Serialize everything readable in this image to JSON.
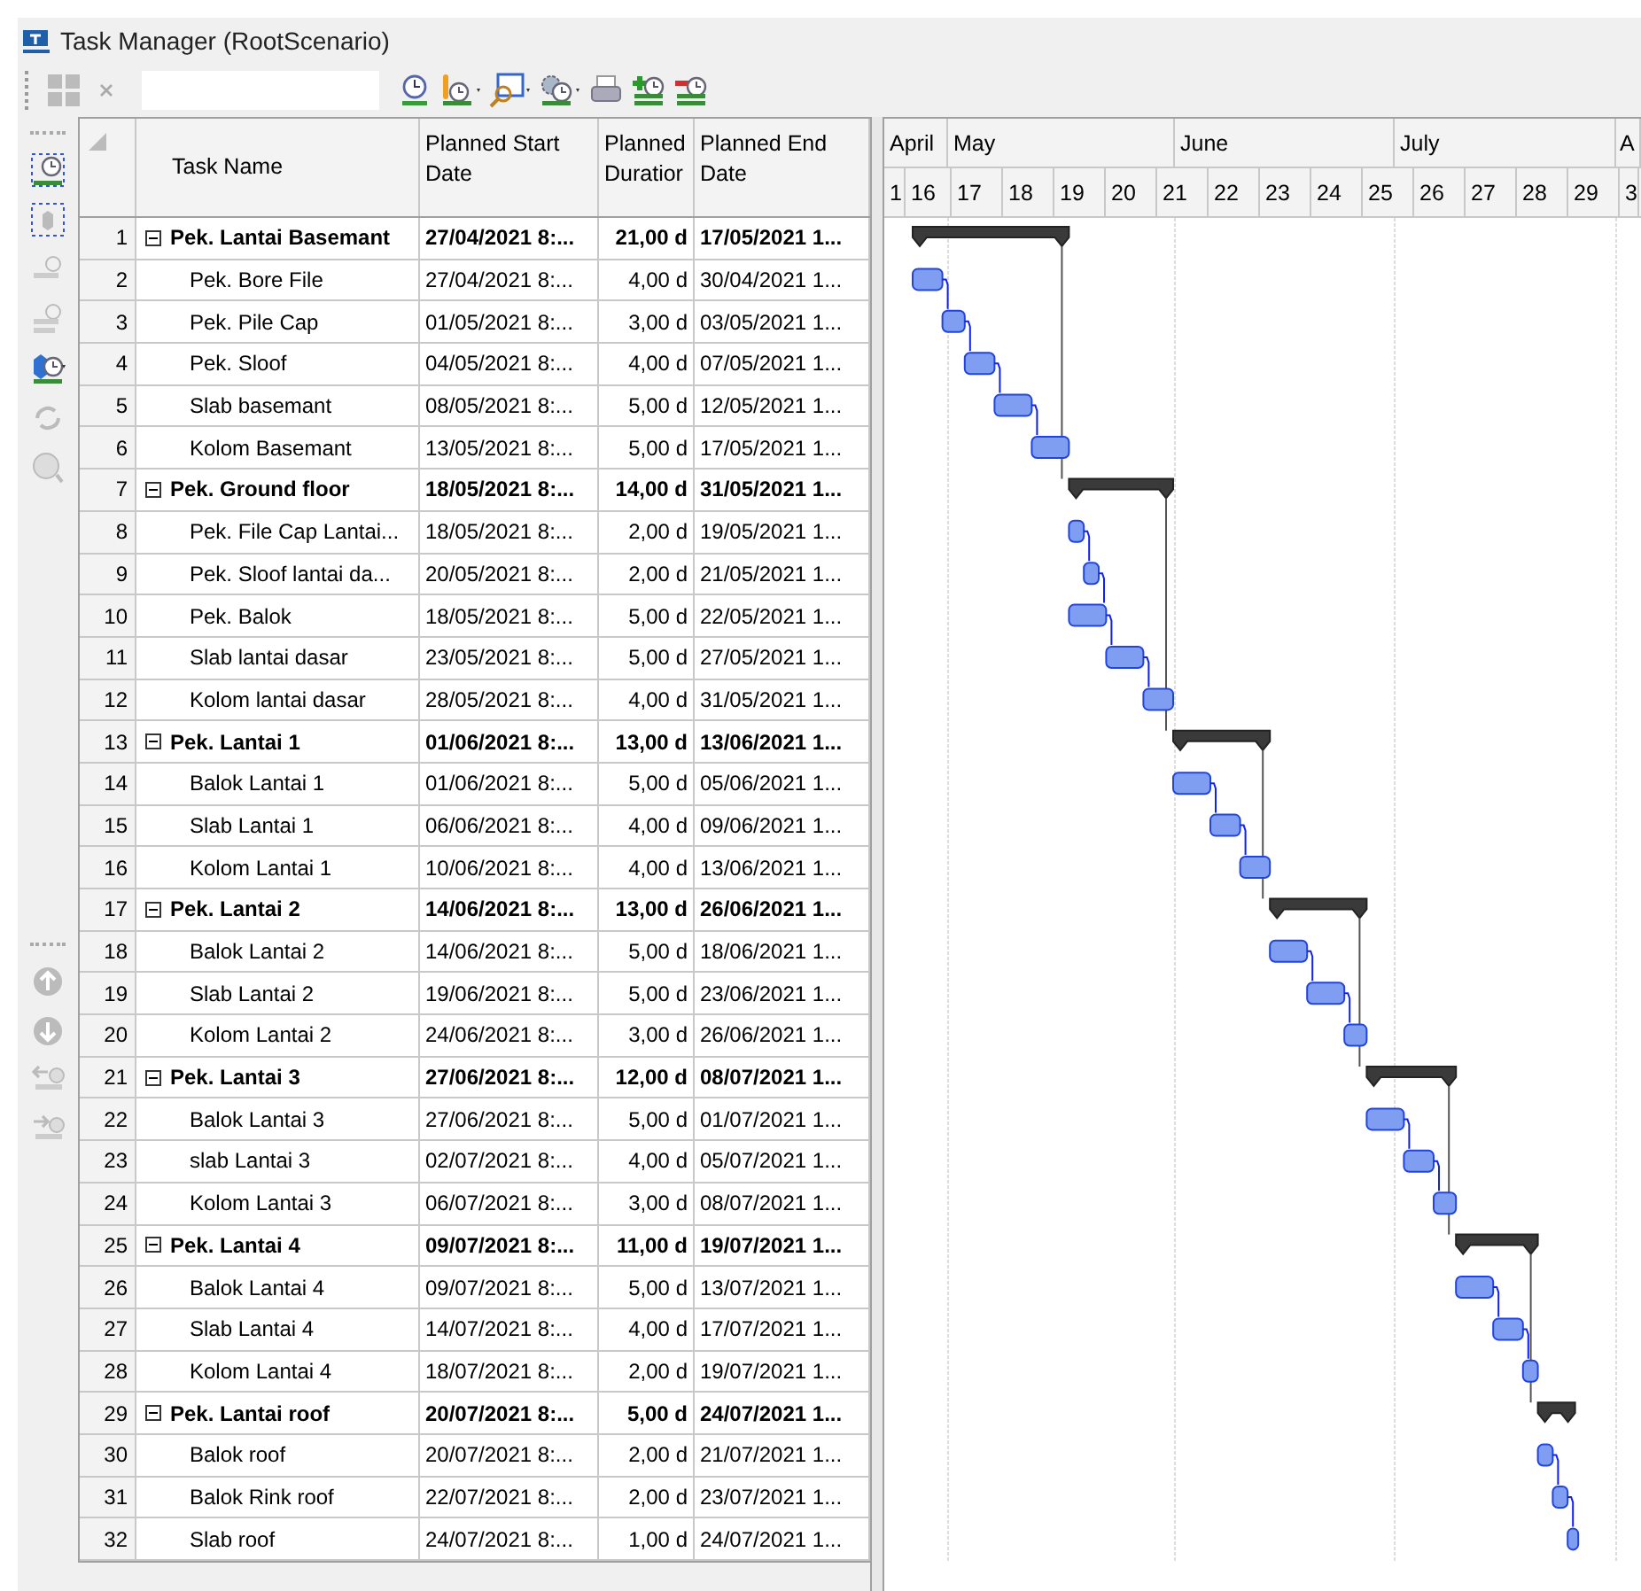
{
  "window": {
    "title": "Task Manager (RootScenario)"
  },
  "table": {
    "columns": [
      "Task Name",
      "Planned Start Date",
      "Planned Duratior",
      "Planned End Date"
    ],
    "rows": [
      {
        "num": "1",
        "kind": "summary",
        "expanded": true,
        "name": "Pek. Lantai Basemant",
        "start": "27/04/2021 8:...",
        "duration": "21,00 d",
        "end": "17/05/2021 1..."
      },
      {
        "num": "2",
        "kind": "task",
        "name": "Pek. Bore File",
        "start": "27/04/2021 8:...",
        "duration": "4,00 d",
        "end": "30/04/2021 1..."
      },
      {
        "num": "3",
        "kind": "task",
        "name": "Pek. Pile Cap",
        "start": "01/05/2021 8:...",
        "duration": "3,00 d",
        "end": "03/05/2021 1..."
      },
      {
        "num": "4",
        "kind": "task",
        "name": "Pek. Sloof",
        "start": "04/05/2021 8:...",
        "duration": "4,00 d",
        "end": "07/05/2021 1..."
      },
      {
        "num": "5",
        "kind": "task",
        "name": "Slab basemant",
        "start": "08/05/2021 8:...",
        "duration": "5,00 d",
        "end": "12/05/2021 1..."
      },
      {
        "num": "6",
        "kind": "task",
        "name": "Kolom Basemant",
        "start": "13/05/2021 8:...",
        "duration": "5,00 d",
        "end": "17/05/2021 1..."
      },
      {
        "num": "7",
        "kind": "summary",
        "expanded": true,
        "name": "Pek. Ground floor",
        "start": "18/05/2021 8:...",
        "duration": "14,00 d",
        "end": "31/05/2021 1..."
      },
      {
        "num": "8",
        "kind": "task",
        "name": "Pek. File Cap Lantai...",
        "start": "18/05/2021 8:...",
        "duration": "2,00 d",
        "end": "19/05/2021 1..."
      },
      {
        "num": "9",
        "kind": "task",
        "name": "Pek. Sloof lantai da...",
        "start": "20/05/2021 8:...",
        "duration": "2,00 d",
        "end": "21/05/2021 1..."
      },
      {
        "num": "10",
        "kind": "task",
        "name": "Pek. Balok",
        "start": "18/05/2021 8:...",
        "duration": "5,00 d",
        "end": "22/05/2021 1..."
      },
      {
        "num": "11",
        "kind": "task",
        "name": "Slab lantai dasar",
        "start": "23/05/2021 8:...",
        "duration": "5,00 d",
        "end": "27/05/2021 1..."
      },
      {
        "num": "12",
        "kind": "task",
        "name": "Kolom lantai dasar",
        "start": "28/05/2021 8:...",
        "duration": "4,00 d",
        "end": "31/05/2021 1..."
      },
      {
        "num": "13",
        "kind": "summary",
        "expanded": true,
        "name": "Pek. Lantai 1",
        "start": "01/06/2021 8:...",
        "duration": "13,00 d",
        "end": "13/06/2021 1..."
      },
      {
        "num": "14",
        "kind": "task",
        "name": "Balok Lantai 1",
        "start": "01/06/2021 8:...",
        "duration": "5,00 d",
        "end": "05/06/2021 1..."
      },
      {
        "num": "15",
        "kind": "task",
        "name": "Slab Lantai 1",
        "start": "06/06/2021 8:...",
        "duration": "4,00 d",
        "end": "09/06/2021 1..."
      },
      {
        "num": "16",
        "kind": "task",
        "name": "Kolom Lantai 1",
        "start": "10/06/2021 8:...",
        "duration": "4,00 d",
        "end": "13/06/2021 1..."
      },
      {
        "num": "17",
        "kind": "summary",
        "expanded": true,
        "name": "Pek. Lantai 2",
        "start": "14/06/2021 8:...",
        "duration": "13,00 d",
        "end": "26/06/2021 1..."
      },
      {
        "num": "18",
        "kind": "task",
        "name": "Balok Lantai 2",
        "start": "14/06/2021 8:...",
        "duration": "5,00 d",
        "end": "18/06/2021 1..."
      },
      {
        "num": "19",
        "kind": "task",
        "name": "Slab Lantai 2",
        "start": "19/06/2021 8:...",
        "duration": "5,00 d",
        "end": "23/06/2021 1..."
      },
      {
        "num": "20",
        "kind": "task",
        "name": "Kolom Lantai 2",
        "start": "24/06/2021 8:...",
        "duration": "3,00 d",
        "end": "26/06/2021 1..."
      },
      {
        "num": "21",
        "kind": "summary",
        "expanded": true,
        "name": "Pek. Lantai 3",
        "start": "27/06/2021 8:...",
        "duration": "12,00 d",
        "end": "08/07/2021 1..."
      },
      {
        "num": "22",
        "kind": "task",
        "name": "Balok Lantai 3",
        "start": "27/06/2021 8:...",
        "duration": "5,00 d",
        "end": "01/07/2021 1..."
      },
      {
        "num": "23",
        "kind": "task",
        "name": "slab Lantai 3",
        "start": "02/07/2021 8:...",
        "duration": "4,00 d",
        "end": "05/07/2021 1..."
      },
      {
        "num": "24",
        "kind": "task",
        "name": "Kolom Lantai 3",
        "start": "06/07/2021 8:...",
        "duration": "3,00 d",
        "end": "08/07/2021 1..."
      },
      {
        "num": "25",
        "kind": "summary",
        "expanded": true,
        "name": "Pek. Lantai 4",
        "start": "09/07/2021 8:...",
        "duration": "11,00 d",
        "end": "19/07/2021 1..."
      },
      {
        "num": "26",
        "kind": "task",
        "name": "Balok Lantai 4",
        "start": "09/07/2021 8:...",
        "duration": "5,00 d",
        "end": "13/07/2021 1..."
      },
      {
        "num": "27",
        "kind": "task",
        "name": "Slab Lantai 4",
        "start": "14/07/2021 8:...",
        "duration": "4,00 d",
        "end": "17/07/2021 1..."
      },
      {
        "num": "28",
        "kind": "task",
        "name": "Kolom Lantai 4",
        "start": "18/07/2021 8:...",
        "duration": "2,00 d",
        "end": "19/07/2021 1..."
      },
      {
        "num": "29",
        "kind": "summary",
        "expanded": true,
        "name": "Pek. Lantai roof",
        "start": "20/07/2021 8:...",
        "duration": "5,00 d",
        "end": "24/07/2021 1..."
      },
      {
        "num": "30",
        "kind": "task",
        "name": "Balok roof",
        "start": "20/07/2021 8:...",
        "duration": "2,00 d",
        "end": "21/07/2021 1..."
      },
      {
        "num": "31",
        "kind": "task",
        "name": "Balok Rink roof",
        "start": "22/07/2021 8:...",
        "duration": "2,00 d",
        "end": "23/07/2021 1..."
      },
      {
        "num": "32",
        "kind": "task",
        "name": "Slab roof",
        "start": "24/07/2021 8:...",
        "duration": "1,00 d",
        "end": "24/07/2021 1..."
      }
    ]
  },
  "gantt": {
    "months": [
      "April",
      "May",
      "June",
      "July",
      "A"
    ],
    "weeks": [
      "1",
      "16",
      "17",
      "18",
      "19",
      "20",
      "21",
      "22",
      "23",
      "24",
      "25",
      "26",
      "27",
      "28",
      "29",
      "3"
    ]
  }
}
